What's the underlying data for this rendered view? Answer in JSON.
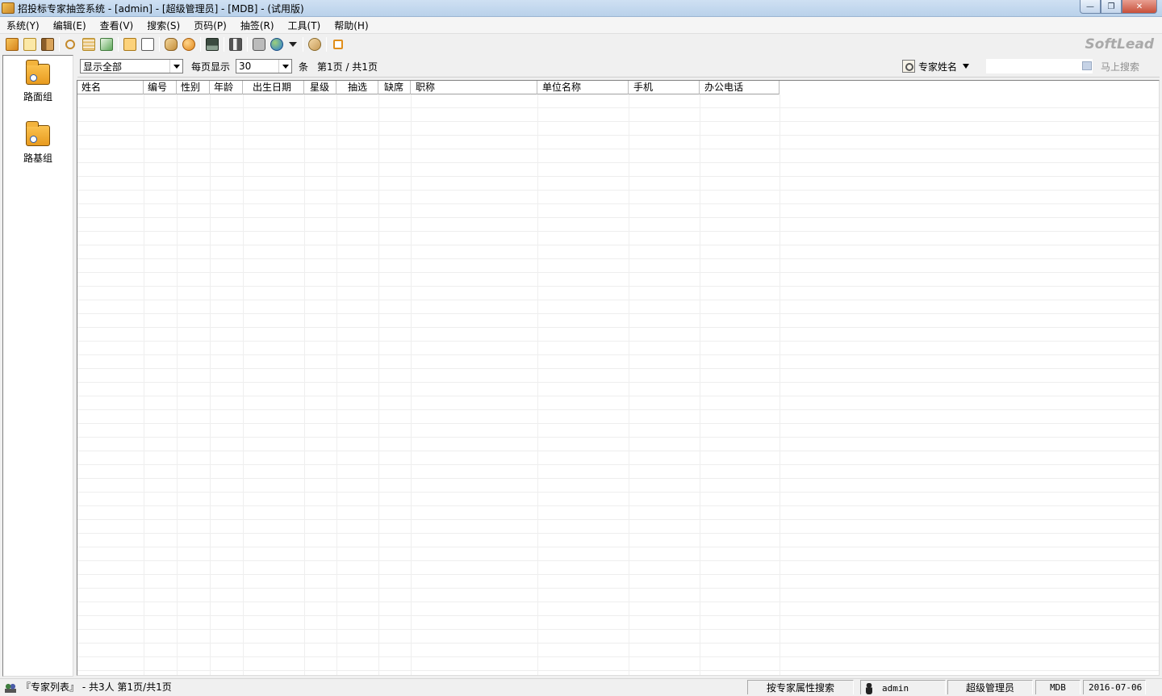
{
  "window": {
    "title": "招投标专家抽签系统  - [admin] - [超级管理员] - [MDB] - (试用版)",
    "min_label": "—",
    "max_label": "❐",
    "close_label": "✕"
  },
  "menu": {
    "items": [
      "系统(Y)",
      "编辑(E)",
      "查看(V)",
      "搜索(S)",
      "页码(P)",
      "抽签(R)",
      "工具(T)",
      "帮助(H)"
    ]
  },
  "toolbar": {
    "brand": "SoftLead",
    "icons": [
      "open-icon",
      "note-icon",
      "book-icon",
      "find-icon",
      "grid-icon",
      "export-icon",
      "copy-icon",
      "paste-icon",
      "handshake-icon",
      "ball-icon",
      "save-icon",
      "tools-icon",
      "database-icon",
      "globe-icon",
      "dropdown-icon",
      "user-icon",
      "exit-icon"
    ]
  },
  "sidebar": {
    "groups": [
      {
        "label": "路面组"
      },
      {
        "label": "路基组"
      }
    ]
  },
  "filter": {
    "display_value": "显示全部",
    "per_page_label": "每页显示",
    "per_page_value": "30",
    "unit_label": "条",
    "page_info": "第1页 / 共1页",
    "search_field": "专家姓名",
    "search_value": "",
    "quick_search": "马上搜索"
  },
  "grid": {
    "columns": [
      "姓名",
      "编号",
      "性别",
      "年龄",
      "出生日期",
      "星级",
      "抽选",
      "缺席",
      "职称",
      "单位名称",
      "手机",
      "办公电话"
    ],
    "rows": []
  },
  "status": {
    "list_info": "『专家列表』 - 共3人 第1页/共1页",
    "search_mode": "按专家属性搜索",
    "user": "admin",
    "role": "超级管理员",
    "db": "MDB",
    "date": "2016-07-06"
  }
}
